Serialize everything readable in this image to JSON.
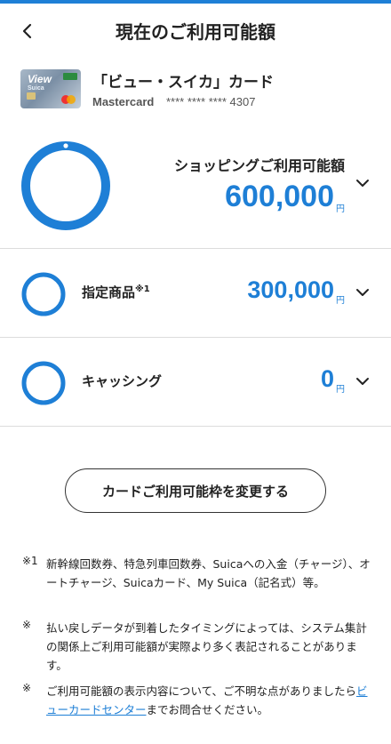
{
  "header": {
    "title": "現在のご利用可能額"
  },
  "card": {
    "name": "「ビュー・スイカ」カード",
    "brand": "Mastercard",
    "number": "**** **** **** 4307",
    "thumb_logo": "View",
    "thumb_sub": "Suica"
  },
  "shopping": {
    "label": "ショッピングご利用可能額",
    "amount": "600,000",
    "unit": "円",
    "ring_fill": 1.0
  },
  "rows": [
    {
      "label": "指定商品",
      "mark": "※1",
      "amount": "300,000",
      "unit": "円",
      "ring_fill": 1.0
    },
    {
      "label": "キャッシング",
      "amount": "0",
      "unit": "円",
      "ring_fill": 1.0
    }
  ],
  "change_button": {
    "label": "カードご利用可能枠を変更する"
  },
  "notes": [
    {
      "mark": "※1",
      "text": "新幹線回数券、特急列車回数券、Suicaへの入金（チャージ）、オートチャージ、Suicaカード、My Suica（記名式）等。"
    },
    {
      "mark": "※",
      "text": "払い戻しデータが到着したタイミングによっては、システム集計の関係上ご利用可能額が実際より多く表記されることがあります。"
    },
    {
      "mark": "※",
      "text_before": "ご利用可能額の表示内容について、ご不明な点がありましたら",
      "link": "ビューカードセンター",
      "text_after": "までお問合せください。"
    }
  ],
  "colors": {
    "accent": "#1e7fd6",
    "divider": "#dcdcdc"
  },
  "icons": {
    "back": "chevron-left-icon",
    "expand": "chevron-down-icon"
  }
}
